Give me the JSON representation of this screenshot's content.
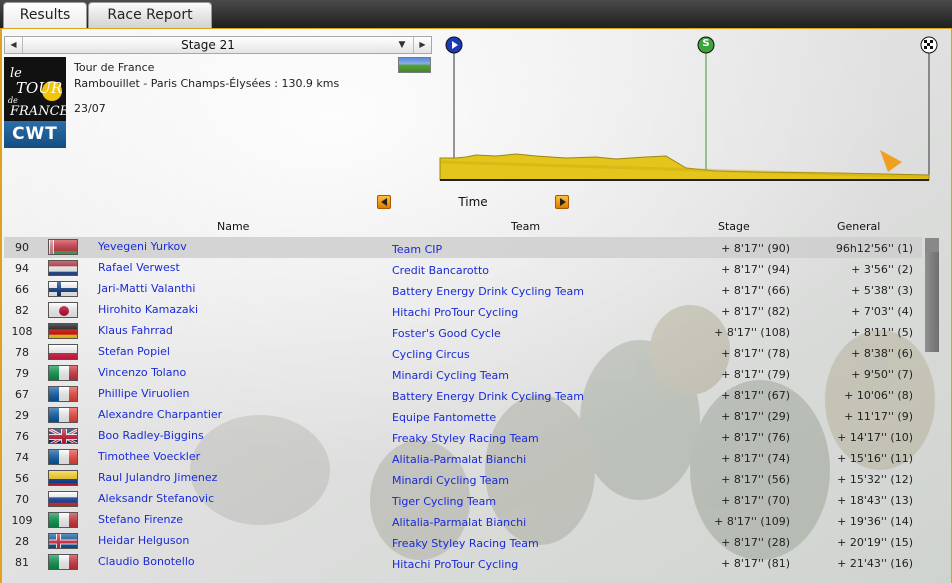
{
  "tabs": [
    {
      "label": "Results",
      "active": true
    },
    {
      "label": "Race Report",
      "active": false
    }
  ],
  "stage_selector": {
    "value": "Stage 21",
    "prev_icon": "left-triangle-icon",
    "next_icon": "right-triangle-icon",
    "dropdown_icon": "chevron-down-icon"
  },
  "race": {
    "name": "Tour de France",
    "route": "Rambouillet - Paris Champs-Élysées : 130.9 kms",
    "date": "23/07",
    "category": "CWT",
    "logo_text": "le TOUR de FRANCE"
  },
  "profile": {
    "start_icon": "start-flag-icon",
    "sprint_marker": "S",
    "finish_icon": "checkered-flag-icon"
  },
  "classification": {
    "label": "Time",
    "prev_icon": "left-triangle-icon",
    "next_icon": "right-triangle-icon"
  },
  "columns": {
    "name": "Name",
    "team": "Team",
    "stage": "Stage",
    "general": "General"
  },
  "colors": {
    "accent": "#e0a020",
    "link": "#1a2ad8",
    "cwt": "#1c5a92"
  },
  "rows": [
    {
      "num": "90",
      "flag": "Belarus",
      "name": "Yevegeni Yurkov",
      "team": "Team CIP",
      "stage": "+ 8'17'' (90)",
      "general": "96h12'56'' (1)",
      "selected": true
    },
    {
      "num": "94",
      "flag": "Netherlands",
      "name": "Rafael Verwest",
      "team": "Credit Bancarotto",
      "stage": "+ 8'17'' (94)",
      "general": "+ 3'56'' (2)"
    },
    {
      "num": "66",
      "flag": "Finland",
      "name": "Jari-Matti Valanthi",
      "team": "Battery Energy Drink Cycling Team",
      "stage": "+ 8'17'' (66)",
      "general": "+ 5'38'' (3)"
    },
    {
      "num": "82",
      "flag": "Japan",
      "name": "Hirohito Kamazaki",
      "team": "Hitachi ProTour Cycling",
      "stage": "+ 8'17'' (82)",
      "general": "+ 7'03'' (4)"
    },
    {
      "num": "108",
      "flag": "Germany",
      "name": "Klaus Fahrrad",
      "team": "Foster's Good Cycle",
      "stage": "+ 8'17'' (108)",
      "general": "+ 8'11'' (5)"
    },
    {
      "num": "78",
      "flag": "Poland",
      "name": "Stefan Popiel",
      "team": "Cycling Circus",
      "stage": "+ 8'17'' (78)",
      "general": "+ 8'38'' (6)"
    },
    {
      "num": "79",
      "flag": "Italy",
      "name": "Vincenzo Tolano",
      "team": "Minardi Cycling Team",
      "stage": "+ 8'17'' (79)",
      "general": "+ 9'50'' (7)"
    },
    {
      "num": "67",
      "flag": "France",
      "name": "Phillipe Viruolien",
      "team": "Battery Energy Drink Cycling Team",
      "stage": "+ 8'17'' (67)",
      "general": "+ 10'06'' (8)"
    },
    {
      "num": "29",
      "flag": "France",
      "name": "Alexandre Charpantier",
      "team": "Equipe Fantomette",
      "stage": "+ 8'17'' (29)",
      "general": "+ 11'17'' (9)"
    },
    {
      "num": "76",
      "flag": "United Kingdom",
      "name": "Boo Radley-Biggins",
      "team": "Freaky Styley Racing Team",
      "stage": "+ 8'17'' (76)",
      "general": "+ 14'17'' (10)"
    },
    {
      "num": "74",
      "flag": "France",
      "name": "Timothee Voeckler",
      "team": "Alitalia-Parmalat Bianchi",
      "stage": "+ 8'17'' (74)",
      "general": "+ 15'16'' (11)"
    },
    {
      "num": "56",
      "flag": "Colombia",
      "name": "Raul Julandro Jimenez",
      "team": "Minardi Cycling Team",
      "stage": "+ 8'17'' (56)",
      "general": "+ 15'32'' (12)"
    },
    {
      "num": "70",
      "flag": "Russia",
      "name": "Aleksandr Stefanovic",
      "team": "Tiger Cycling Team",
      "stage": "+ 8'17'' (70)",
      "general": "+ 18'43'' (13)"
    },
    {
      "num": "109",
      "flag": "Italy",
      "name": "Stefano Firenze",
      "team": "Alitalia-Parmalat Bianchi",
      "stage": "+ 8'17'' (109)",
      "general": "+ 19'36'' (14)"
    },
    {
      "num": "28",
      "flag": "Iceland",
      "name": "Heidar Helguson",
      "team": "Freaky Styley Racing Team",
      "stage": "+ 8'17'' (28)",
      "general": "+ 20'19'' (15)"
    },
    {
      "num": "81",
      "flag": "Italy",
      "name": "Claudio Bonotello",
      "team": "Hitachi ProTour Cycling",
      "stage": "+ 8'17'' (81)",
      "general": "+ 21'43'' (16)"
    }
  ]
}
